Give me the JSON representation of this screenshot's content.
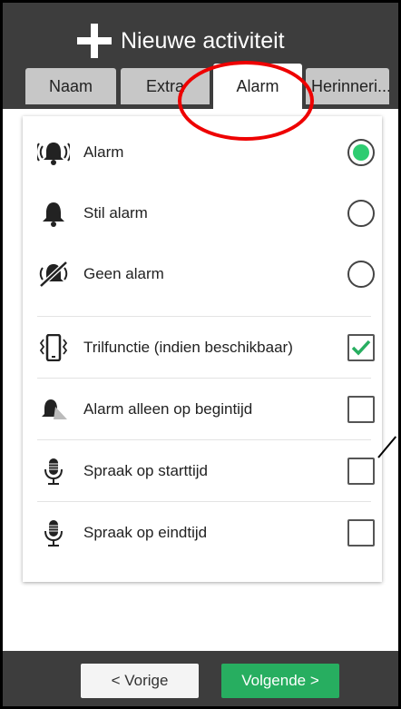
{
  "header": {
    "title": "Nieuwe activiteit"
  },
  "tabs": [
    {
      "label": "Naam",
      "active": false
    },
    {
      "label": "Extra",
      "active": false
    },
    {
      "label": "Alarm",
      "active": true
    },
    {
      "label": "Herinneri...",
      "active": false
    }
  ],
  "alarm_options": [
    {
      "label": "Alarm",
      "icon": "bell-ringing-icon",
      "control": "radio",
      "selected": true
    },
    {
      "label": "Stil alarm",
      "icon": "bell-icon",
      "control": "radio",
      "selected": false
    },
    {
      "label": "Geen alarm",
      "icon": "bell-off-icon",
      "control": "radio",
      "selected": false
    },
    {
      "label": "Trilfunctie (indien beschikbaar)",
      "icon": "phone-vibrate-icon",
      "control": "checkbox",
      "checked": true
    },
    {
      "label": "Alarm alleen op begintijd",
      "icon": "bell-start-only-icon",
      "control": "checkbox",
      "checked": false
    },
    {
      "label": "Spraak op starttijd",
      "icon": "microphone-icon",
      "control": "checkbox",
      "checked": false
    },
    {
      "label": "Spraak op eindtijd",
      "icon": "microphone-icon",
      "control": "checkbox",
      "checked": false
    }
  ],
  "footer": {
    "prev_label": "< Vorige",
    "next_label": "Volgende >"
  },
  "colors": {
    "accent_green": "#27ae60",
    "radio_green": "#2ecc71",
    "annotation_red": "#e00000",
    "bar": "#3d3d3d"
  }
}
